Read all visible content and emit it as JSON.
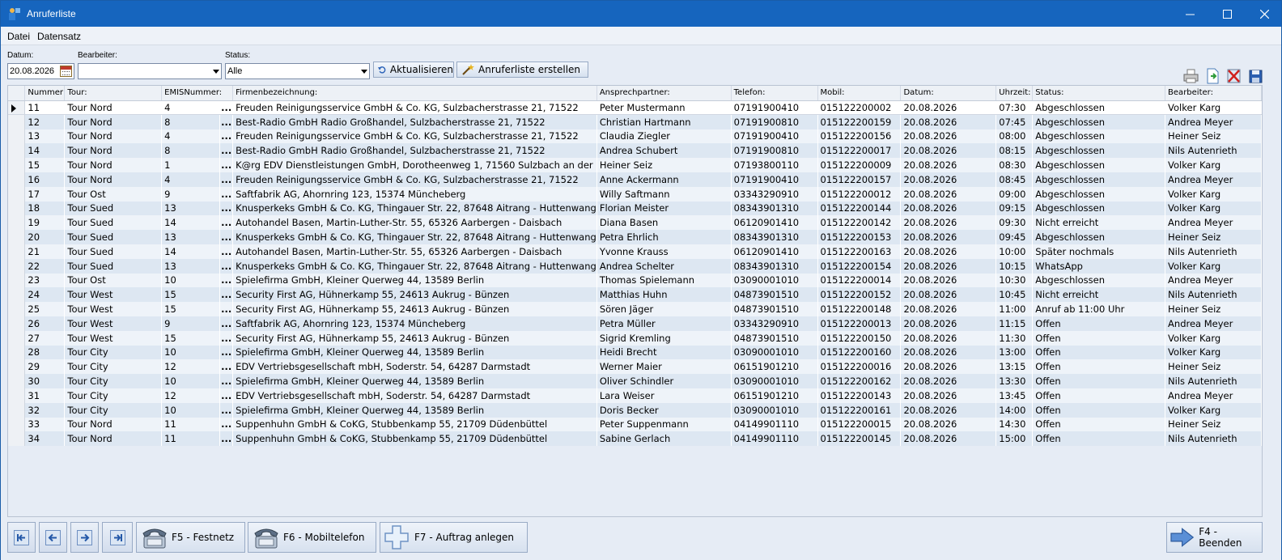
{
  "window": {
    "title": "Anruferliste"
  },
  "menu": {
    "items": [
      "Datei",
      "Datensatz"
    ]
  },
  "filters": {
    "datum_label": "Datum:",
    "datum_value": "20.08.2026",
    "bearbeiter_label": "Bearbeiter:",
    "bearbeiter_value": "",
    "status_label": "Status:",
    "status_value": "Alle"
  },
  "toolbar": {
    "refresh_label": "Aktualisieren",
    "create_label": "Anruferliste erstellen"
  },
  "grid": {
    "columns": [
      "Nummer",
      "Tour:",
      "EMISNummer:",
      "Firmenbezeichnung:",
      "Ansprechpartner:",
      "Telefon:",
      "Mobil:",
      "Datum:",
      "Uhrzeit:",
      "Status:",
      "Bearbeiter:"
    ],
    "rows": [
      [
        "11",
        "Tour Nord",
        "4",
        "Freuden Reinigungsservice GmbH & Co. KG, Sulzbacherstrasse 21, 71522",
        "Peter Mustermann",
        "07191900410",
        "015122200002",
        "20.08.2026",
        "07:30",
        "Abgeschlossen",
        "Volker Karg"
      ],
      [
        "12",
        "Tour Nord",
        "8",
        "Best-Radio GmbH Radio Großhandel, Sulzbacherstrasse 21, 71522",
        "Christian Hartmann",
        "07191900810",
        "015122200159",
        "20.08.2026",
        "07:45",
        "Abgeschlossen",
        "Andrea Meyer"
      ],
      [
        "13",
        "Tour Nord",
        "4",
        "Freuden Reinigungsservice GmbH & Co. KG, Sulzbacherstrasse 21, 71522",
        "Claudia Ziegler",
        "07191900410",
        "015122200156",
        "20.08.2026",
        "08:00",
        "Abgeschlossen",
        "Heiner Seiz"
      ],
      [
        "14",
        "Tour Nord",
        "8",
        "Best-Radio GmbH Radio Großhandel, Sulzbacherstrasse 21, 71522",
        "Andrea Schubert",
        "07191900810",
        "015122200017",
        "20.08.2026",
        "08:15",
        "Abgeschlossen",
        "Nils Autenrieth"
      ],
      [
        "15",
        "Tour Nord",
        "1",
        "K@rg EDV Dienstleistungen GmbH, Dorotheenweg 1, 71560 Sulzbach an der",
        "Heiner Seiz",
        "07193800110",
        "015122200009",
        "20.08.2026",
        "08:30",
        "Abgeschlossen",
        "Volker Karg"
      ],
      [
        "16",
        "Tour Nord",
        "4",
        "Freuden Reinigungsservice GmbH & Co. KG, Sulzbacherstrasse 21, 71522",
        "Anne Ackermann",
        "07191900410",
        "015122200157",
        "20.08.2026",
        "08:45",
        "Abgeschlossen",
        "Andrea Meyer"
      ],
      [
        "17",
        "Tour Ost",
        "9",
        "Saftfabrik AG, Ahornring 123, 15374 Müncheberg",
        "Willy Saftmann",
        "03343290910",
        "015122200012",
        "20.08.2026",
        "09:00",
        "Abgeschlossen",
        "Volker Karg"
      ],
      [
        "18",
        "Tour Sued",
        "13",
        "Knusperkeks GmbH & Co. KG, Thingauer Str. 22, 87648 Aitrang - Huttenwang",
        "Florian Meister",
        "08343901310",
        "015122200144",
        "20.08.2026",
        "09:15",
        "Abgeschlossen",
        "Volker Karg"
      ],
      [
        "19",
        "Tour Sued",
        "14",
        "Autohandel Basen, Martin-Luther-Str. 55, 65326 Aarbergen - Daisbach",
        "Diana Basen",
        "06120901410",
        "015122200142",
        "20.08.2026",
        "09:30",
        "Nicht erreicht",
        "Andrea Meyer"
      ],
      [
        "20",
        "Tour Sued",
        "13",
        "Knusperkeks GmbH & Co. KG, Thingauer Str. 22, 87648 Aitrang - Huttenwang",
        "Petra Ehrlich",
        "08343901310",
        "015122200153",
        "20.08.2026",
        "09:45",
        "Abgeschlossen",
        "Heiner Seiz"
      ],
      [
        "21",
        "Tour Sued",
        "14",
        "Autohandel Basen, Martin-Luther-Str. 55, 65326 Aarbergen - Daisbach",
        "Yvonne Krauss",
        "06120901410",
        "015122200163",
        "20.08.2026",
        "10:00",
        "Später nochmals",
        "Nils Autenrieth"
      ],
      [
        "22",
        "Tour Sued",
        "13",
        "Knusperkeks GmbH & Co. KG, Thingauer Str. 22, 87648 Aitrang - Huttenwang",
        "Andrea Schelter",
        "08343901310",
        "015122200154",
        "20.08.2026",
        "10:15",
        "WhatsApp",
        "Volker Karg"
      ],
      [
        "23",
        "Tour Ost",
        "10",
        "Spielefirma GmbH, Kleiner Querweg 44, 13589 Berlin",
        "Thomas Spielemann",
        "03090001010",
        "015122200014",
        "20.08.2026",
        "10:30",
        "Abgeschlossen",
        "Andrea Meyer"
      ],
      [
        "24",
        "Tour West",
        "15",
        "Security First AG, Hühnerkamp 55, 24613 Aukrug - Bünzen",
        "Matthias Huhn",
        "04873901510",
        "015122200152",
        "20.08.2026",
        "10:45",
        "Nicht erreicht",
        "Nils Autenrieth"
      ],
      [
        "25",
        "Tour West",
        "15",
        "Security First AG, Hühnerkamp 55, 24613 Aukrug - Bünzen",
        "Sören Jäger",
        "04873901510",
        "015122200148",
        "20.08.2026",
        "11:00",
        "Anruf ab 11:00 Uhr",
        "Heiner Seiz"
      ],
      [
        "26",
        "Tour West",
        "9",
        "Saftfabrik AG, Ahornring 123, 15374 Müncheberg",
        "Petra Müller",
        "03343290910",
        "015122200013",
        "20.08.2026",
        "11:15",
        "Offen",
        "Andrea Meyer"
      ],
      [
        "27",
        "Tour West",
        "15",
        "Security First AG, Hühnerkamp 55, 24613 Aukrug - Bünzen",
        "Sigrid Kremling",
        "04873901510",
        "015122200150",
        "20.08.2026",
        "11:30",
        "Offen",
        "Volker Karg"
      ],
      [
        "28",
        "Tour City",
        "10",
        "Spielefirma GmbH, Kleiner Querweg 44, 13589 Berlin",
        "Heidi Brecht",
        "03090001010",
        "015122200160",
        "20.08.2026",
        "13:00",
        "Offen",
        "Volker Karg"
      ],
      [
        "29",
        "Tour City",
        "12",
        "EDV Vertriebsgesellschaft mbH, Soderstr. 54, 64287 Darmstadt",
        "Werner Maier",
        "06151901210",
        "015122200016",
        "20.08.2026",
        "13:15",
        "Offen",
        "Heiner Seiz"
      ],
      [
        "30",
        "Tour City",
        "10",
        "Spielefirma GmbH, Kleiner Querweg 44, 13589 Berlin",
        "Oliver Schindler",
        "03090001010",
        "015122200162",
        "20.08.2026",
        "13:30",
        "Offen",
        "Nils Autenrieth"
      ],
      [
        "31",
        "Tour City",
        "12",
        "EDV Vertriebsgesellschaft mbH, Soderstr. 54, 64287 Darmstadt",
        "Lara Weiser",
        "06151901210",
        "015122200143",
        "20.08.2026",
        "13:45",
        "Offen",
        "Andrea Meyer"
      ],
      [
        "32",
        "Tour City",
        "10",
        "Spielefirma GmbH, Kleiner Querweg 44, 13589 Berlin",
        "Doris Becker",
        "03090001010",
        "015122200161",
        "20.08.2026",
        "14:00",
        "Offen",
        "Volker Karg"
      ],
      [
        "33",
        "Tour Nord",
        "11",
        "Suppenhuhn GmbH & CoKG, Stubbenkamp 55, 21709 Düdenbüttel",
        "Peter Suppenmann",
        "04149901110",
        "015122200015",
        "20.08.2026",
        "14:30",
        "Offen",
        "Heiner Seiz"
      ],
      [
        "34",
        "Tour Nord",
        "11",
        "Suppenhuhn GmbH & CoKG, Stubbenkamp 55, 21709 Düdenbüttel",
        "Sabine Gerlach",
        "04149901110",
        "015122200145",
        "20.08.2026",
        "15:00",
        "Offen",
        "Nils Autenrieth"
      ]
    ],
    "ellipsis": "..."
  },
  "bottom": {
    "f5_label": "F5 - Festnetz",
    "f6_label": "F6 - Mobiltelefon",
    "f7_label": "F7 - Auftrag anlegen",
    "f4_label": "F4 - Beenden"
  },
  "colors": {
    "titlebar": "#1665be",
    "grid_odd": "#dde7f2",
    "grid_even": "#eef3f9",
    "background": "#e6ecf5"
  }
}
